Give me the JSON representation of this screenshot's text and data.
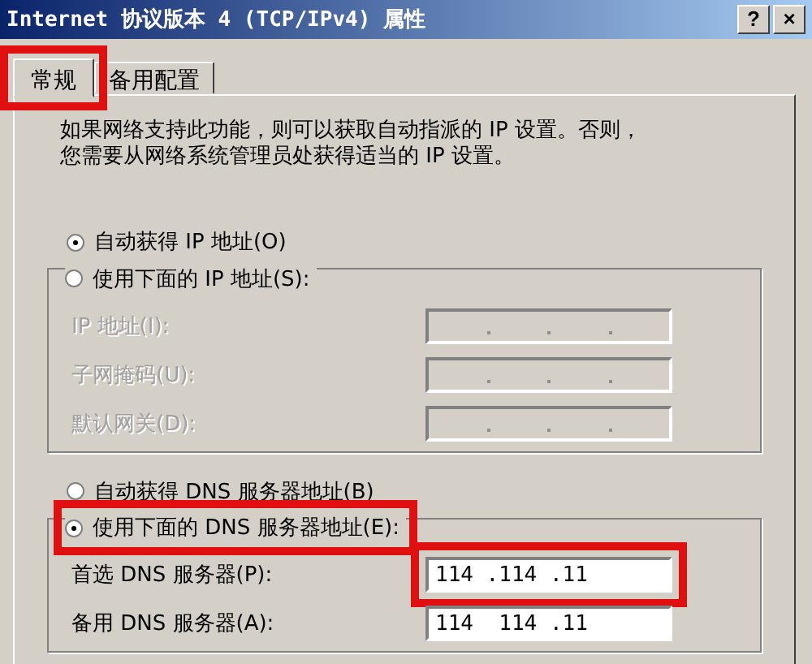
{
  "window": {
    "title": "Internet 协议版本 4 (TCP/IPv4) 属性",
    "buttons": [
      "?",
      "×"
    ]
  },
  "tabs": [
    {
      "label": "常规",
      "selected": true,
      "highlighted": true
    },
    {
      "label": "备用配置",
      "selected": false,
      "highlighted": false
    }
  ],
  "description": [
    "如果网络支持此功能，则可以获取自动指派的 IP 设置。否则，",
    "您需要从网络系统管理员处获得适当的 IP 设置。"
  ],
  "ip_section": {
    "options": [
      {
        "label": "自动获得 IP 地址(O)",
        "selected": true,
        "highlighted": false
      },
      {
        "label": "使用下面的 IP 地址(S):",
        "selected": false,
        "highlighted": false
      }
    ],
    "fields": [
      {
        "label": "IP 地址(I):",
        "disabled": true,
        "highlighted": false
      },
      {
        "label": "子网掩码(U):",
        "disabled": true,
        "highlighted": false
      },
      {
        "label": "默认网关(D):",
        "disabled": true,
        "highlighted": false
      }
    ]
  },
  "dns_section": {
    "options": [
      {
        "label": "自动获得 DNS 服务器地址(B)",
        "selected": false,
        "highlighted": false
      },
      {
        "label": "使用下面的 DNS 服务器地址(E):",
        "selected": true,
        "highlighted": true
      }
    ],
    "fields": [
      {
        "label": "首选 DNS 服务器(P):",
        "value": "114 .114 .11",
        "disabled": false,
        "highlighted": true
      },
      {
        "label": "备用 DNS 服务器(A):",
        "value": "114  114 .11",
        "disabled": false,
        "highlighted": false
      }
    ]
  }
}
